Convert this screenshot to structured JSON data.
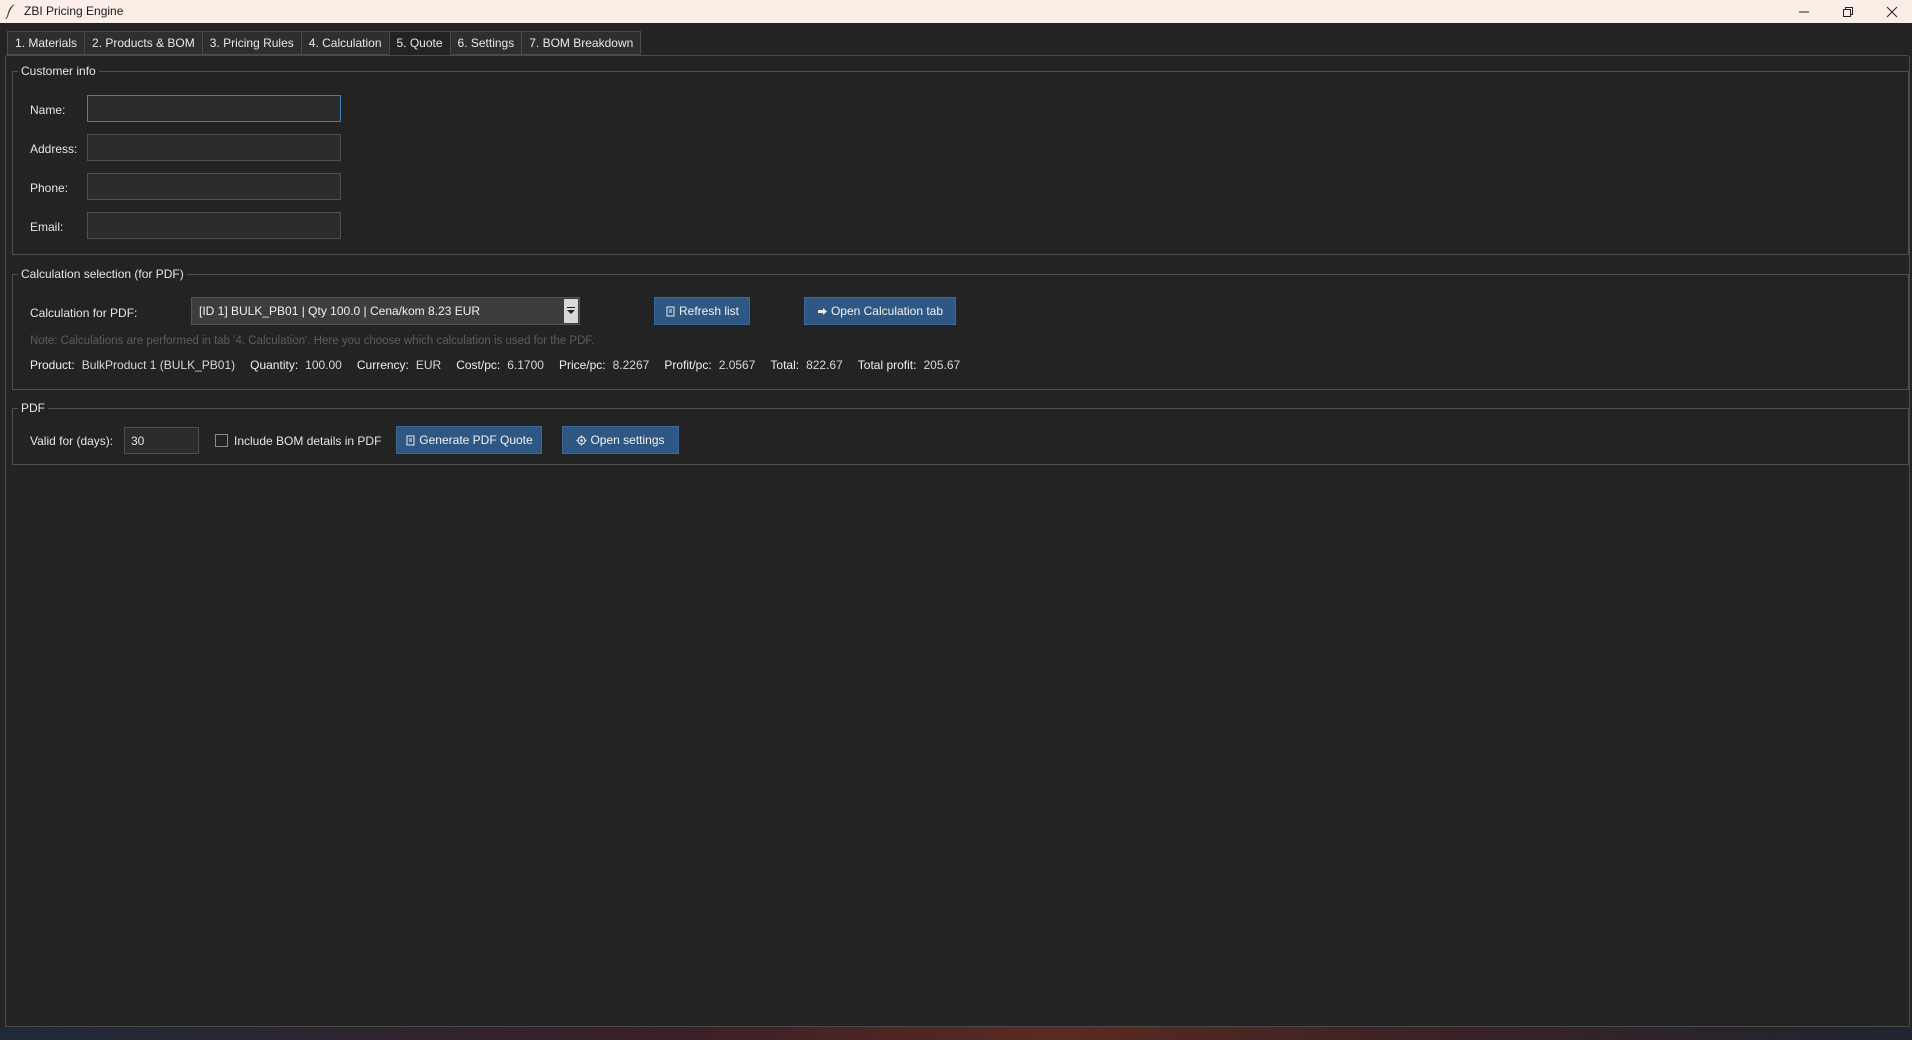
{
  "window": {
    "title": "ZBI Pricing Engine"
  },
  "tabs": [
    {
      "label": "1. Materials",
      "active": false
    },
    {
      "label": "2. Products & BOM",
      "active": false
    },
    {
      "label": "3. Pricing Rules",
      "active": false
    },
    {
      "label": "4. Calculation",
      "active": false
    },
    {
      "label": "5. Quote",
      "active": true
    },
    {
      "label": "6. Settings",
      "active": false
    },
    {
      "label": "7. BOM Breakdown",
      "active": false
    }
  ],
  "customer": {
    "title": "Customer info",
    "name_label": "Name:",
    "name_value": "",
    "address_label": "Address:",
    "address_value": "",
    "phone_label": "Phone:",
    "phone_value": "",
    "email_label": "Email:",
    "email_value": ""
  },
  "calc": {
    "title": "Calculation selection (for PDF)",
    "select_label": "Calculation for PDF:",
    "selected": "[ID 1] BULK_PB01 | Qty 100.0 | Cena/kom 8.23 EUR",
    "refresh_label": "Refresh list",
    "open_calc_label": "Open Calculation tab",
    "note": "Note: Calculations are performed in tab '4. Calculation'. Here you choose which calculation is used for the PDF.",
    "info": {
      "product_k": "Product:",
      "product_v": "BulkProduct 1 (BULK_PB01)",
      "quantity_k": "Quantity:",
      "quantity_v": "100.00",
      "currency_k": "Currency:",
      "currency_v": "EUR",
      "cost_k": "Cost/pc:",
      "cost_v": "6.1700",
      "price_k": "Price/pc:",
      "price_v": "8.2267",
      "profit_k": "Profit/pc:",
      "profit_v": "2.0567",
      "total_k": "Total:",
      "total_v": "822.67",
      "total_profit_k": "Total profit:",
      "total_profit_v": "205.67"
    }
  },
  "pdf": {
    "title": "PDF",
    "valid_label": "Valid for (days):",
    "valid_value": "30",
    "bom_label": "Include BOM details in PDF",
    "bom_checked": false,
    "generate_label": "Generate PDF Quote",
    "settings_label": "Open settings"
  },
  "icons": {
    "app": "feather-icon",
    "refresh": "document-icon",
    "open_calc": "arrow-right-icon",
    "generate": "document-icon",
    "settings": "gear-icon"
  },
  "colors": {
    "background": "#232323",
    "button": "#2f5784",
    "focus": "#3f7fbf"
  }
}
